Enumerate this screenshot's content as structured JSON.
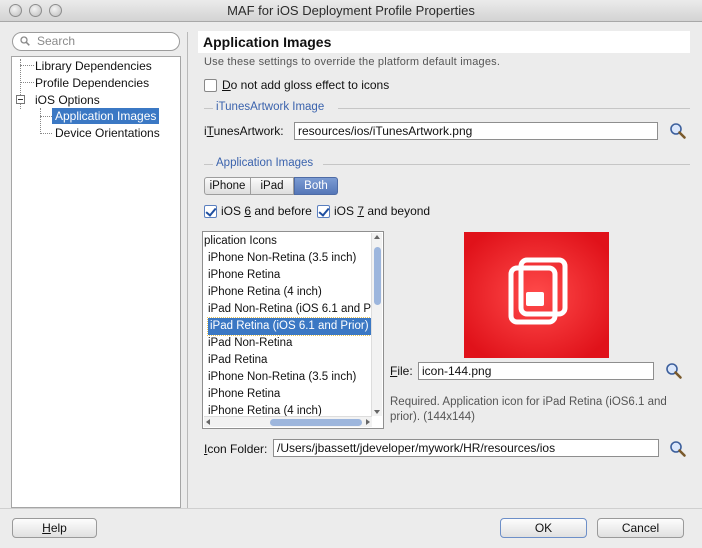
{
  "window": {
    "title": "MAF for iOS Deployment Profile Properties"
  },
  "search": {
    "placeholder": "Search"
  },
  "tree": {
    "items": [
      {
        "label": "Library Dependencies"
      },
      {
        "label": "Profile Dependencies"
      },
      {
        "label": "iOS Options"
      },
      {
        "label": "Application Images",
        "selected": true
      },
      {
        "label": "Device Orientations"
      }
    ]
  },
  "header": {
    "title": "Application Images",
    "subtitle": "Use these settings to override the platform default images."
  },
  "gloss": {
    "label_mnemonic": "D",
    "label_rest": "o not add gloss effect to icons",
    "checked": false
  },
  "itunes": {
    "section_title": "iTunesArtwork Image",
    "field_label_pre": "i",
    "field_label_mnemonic": "T",
    "field_label_rest": "unesArtwork:",
    "value": "resources/ios/iTunesArtwork.png"
  },
  "app_images": {
    "section_title": "Application Images",
    "segments": [
      {
        "label": "iPhone",
        "active": false
      },
      {
        "label": "iPad",
        "active": false
      },
      {
        "label": "Both",
        "active": true
      }
    ],
    "ios6": {
      "pre": "iOS ",
      "mnemonic": "6",
      "rest": " and before",
      "checked": true
    },
    "ios7": {
      "pre": "iOS ",
      "mnemonic": "7",
      "rest": " and beyond",
      "checked": true
    },
    "list": [
      {
        "label": "plication Icons",
        "selected": false
      },
      {
        "label": "iPhone Non-Retina (3.5 inch)",
        "selected": false
      },
      {
        "label": "iPhone Retina",
        "selected": false
      },
      {
        "label": "iPhone Retina (4 inch)",
        "selected": false
      },
      {
        "label": "iPad Non-Retina (iOS 6.1 and P",
        "selected": false
      },
      {
        "label": "iPad Retina (iOS 6.1 and Prior)",
        "selected": true
      },
      {
        "label": "iPad Non-Retina",
        "selected": false
      },
      {
        "label": "iPad Retina",
        "selected": false
      },
      {
        "label": "iPhone Non-Retina (3.5 inch)",
        "selected": false
      },
      {
        "label": "iPhone Retina",
        "selected": false
      },
      {
        "label": "iPhone Retina (4 inch)",
        "selected": false
      }
    ],
    "file_label_mnemonic": "F",
    "file_label_rest": "ile:",
    "file_value": "icon-144.png",
    "description": "Required. Application icon for iPad Retina (iOS6.1 and prior). (144x144)",
    "icon_folder_mnemonic": "I",
    "icon_folder_rest": "con Folder:",
    "icon_folder_value": "/Users/jbassett/jdeveloper/mywork/HR/resources/ios",
    "preview_color": "#e8141c"
  },
  "buttons": {
    "help_mnemonic": "H",
    "help_rest": "elp",
    "ok": "OK",
    "cancel": "Cancel"
  }
}
